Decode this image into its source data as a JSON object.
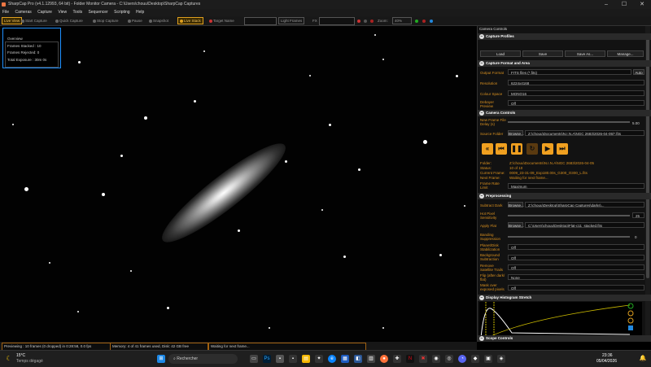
{
  "window": {
    "title": "SharpCap Pro (v4.1.12993, 64 bit) - Folder Monitor Camera - C:\\Users\\chouu\\Desktop\\SharpCap Captures",
    "min": "–",
    "max": "☐",
    "close": "✕"
  },
  "menu": [
    "File",
    "Cameras",
    "Capture",
    "View",
    "Tools",
    "Sequencer",
    "Scripting",
    "Help"
  ],
  "toolbar": {
    "live_view": "Live View",
    "start_capture": "Start Capture",
    "quick_capture": "Quick Capture",
    "stop_capture": "Stop Capture",
    "pause": "Pause",
    "snapshot": "Snapshot",
    "live_stack": "Live Stack",
    "target_name": "Target Name",
    "light_frames": "Light Frames",
    "fx": "FX",
    "zoom_label": "Zoom:",
    "zoom_value": "40%"
  },
  "overview": {
    "title": "Overview",
    "frames_stacked": "Frames Stacked : 10",
    "frames_rejected": "Frames Rejected: 0",
    "total_exposure": "Total Exposure : 30m 0s"
  },
  "status": {
    "preview": "Previewing : 10 frames (0 dropped) in 0:28:58, 0.0 fps",
    "memory": "Memory: 4 of 41 frames used, Disk: 42 GB free",
    "waiting": "Waiting for next frame..."
  },
  "panel": {
    "title": "Camera Controls",
    "capture_profiles": {
      "header": "Capture Profiles",
      "load": "Load",
      "save": "Save",
      "save_as": "Save As...",
      "manage": "Manage..."
    },
    "format": {
      "header": "Capture Format and Area",
      "output_format_label": "Output Format",
      "output_format": "FITS files (*.fits)",
      "auto": "Auto",
      "resolution_label": "Resolution",
      "resolution": "6224x4168",
      "colour_space_label": "Colour Space",
      "colour_space": "MONO16",
      "debayer_label": "Debayer Preview",
      "debayer": "Off"
    },
    "camera": {
      "header": "Camera Controls",
      "new_frame_delay_label": "New Frame File Delay (s)",
      "new_frame_delay": "5.00",
      "source_folder_label": "Source Folder",
      "browse": "Browse...",
      "source_folder": "Z:\\chouu\\Documents\\N.I.N.A\\NGC 2683\\2026-04-05\\*.fits",
      "folder_label": "Folder:",
      "folder": "Z:\\chouu\\Documents\\N.I.N.A\\NGC 2683\\2026-04-05",
      "status_label": "Status:",
      "status": "10 of 10",
      "current_frame_label": "Current Frame:",
      "current_frame": "0009_23-31-09_Exp180.00s_G300_O300_L.fits",
      "next_frame_label": "Next Frame:",
      "next_frame": "Waiting for next frame...",
      "frame_rate_label": "Frame Rate Limit",
      "frame_rate": "Maximum"
    },
    "preprocessing": {
      "header": "Preprocessing",
      "subtract_dark_label": "Subtract Dark",
      "subtract_dark": "Z:\\chouu\\Desktop\\SharpCap Captures\\darks\\...",
      "browse": "Browse...",
      "hot_pixel_label": "Hot Pixel Sensitivity",
      "hot_pixel": "25",
      "apply_flat_label": "Apply Flat",
      "apply_flat": "C:\\Users\\chouu\\Desktop\\Flat-c11_stacked.fits",
      "banding_label": "Banding Suppression",
      "banding": "0",
      "planet_label": "Planet/Disk Stabilization",
      "planet": "Off",
      "background_label": "Background Subtraction",
      "background": "Off",
      "satellite_label": "Remove Satellite Trails",
      "satellite": "Off",
      "flip_label": "Flip (after dark/ flat)",
      "flip": "None",
      "mask_label": "Mask over exposed pixels",
      "mask": "Off"
    },
    "histogram": {
      "header": "Display Histogram Stretch"
    },
    "scope": {
      "header": "Scope Controls"
    }
  },
  "taskbar": {
    "temp": "15°C",
    "weather": "Temps dégagé",
    "search": "Rechercher",
    "time": "23:36",
    "date": "05/04/2026"
  },
  "colors": {
    "accent": "#f0a020",
    "overview_border": "#1e90ff",
    "label": "#d89020"
  }
}
